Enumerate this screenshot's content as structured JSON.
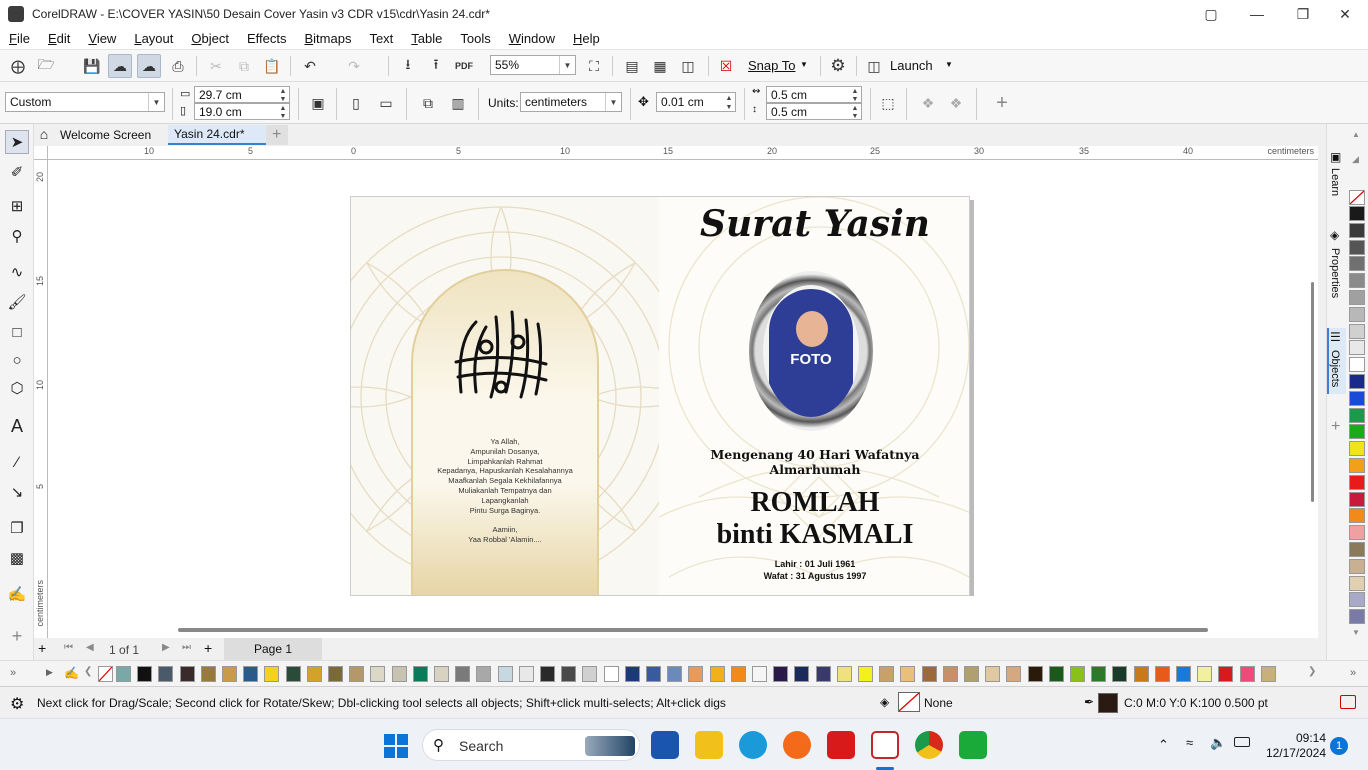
{
  "window": {
    "title": "CorelDRAW - E:\\COVER YASIN\\50 Desain Cover Yasin v3 CDR v15\\cdr\\Yasin 24.cdr*"
  },
  "menu": [
    {
      "key": "F",
      "rest": "ile"
    },
    {
      "key": "E",
      "rest": "dit"
    },
    {
      "key": "V",
      "rest": "iew"
    },
    {
      "key": "L",
      "rest": "ayout"
    },
    {
      "key": "O",
      "rest": "bject"
    },
    {
      "key": "",
      "rest": "Effects"
    },
    {
      "key": "B",
      "rest": "itmaps"
    },
    {
      "key": "",
      "rest": "Text"
    },
    {
      "key": "T",
      "rest": "able"
    },
    {
      "key": "",
      "rest": "Tools"
    },
    {
      "key": "W",
      "rest": "indow"
    },
    {
      "key": "H",
      "rest": "elp"
    }
  ],
  "toolbar": {
    "zoom": "55%",
    "snap_to": "Snap To",
    "launch": "Launch"
  },
  "property_bar": {
    "preset": "Custom",
    "width": "29.7 cm",
    "height": "19.0 cm",
    "units_label": "Units:",
    "units": "centimeters",
    "nudge": "0.01 cm",
    "dup_x": "0.5 cm",
    "dup_y": "0.5 cm"
  },
  "tabs": {
    "welcome": "Welcome Screen",
    "document": "Yasin 24.cdr*"
  },
  "rulers": {
    "unit": "centimeters",
    "h_ticks": [
      "10",
      "5",
      "0",
      "5",
      "10",
      "15",
      "20",
      "25",
      "30",
      "35",
      "40"
    ],
    "v_ticks": [
      "20",
      "15",
      "10",
      "5"
    ]
  },
  "design": {
    "title": "Surat Yasin",
    "photo_label": "FOTO",
    "prayer": [
      "Ya Allah,",
      "Ampunilah Dosanya,",
      "Limpahkanlah Rahmat",
      "Kepadanya, Hapuskanlah Kesalahannya",
      "Maafkanlah Segala Kekhilafannya",
      "Muliakanlah Tempatnya dan",
      "Lapangkanlah",
      "Pintu Surga Baginya.",
      "",
      "Aamiin,",
      "Yaa Robbal 'Alamin...."
    ],
    "memorial_line1": "Mengenang 40 Hari Wafatnya",
    "memorial_line2": "Almarhumah",
    "name_line1": "ROMLAH",
    "name_line2": "binti KASMALI",
    "born": "Lahir : 01 Juli 1961",
    "died": "Wafat : 31 Agustus 1997"
  },
  "dockers": {
    "learn": "Learn",
    "properties": "Properties",
    "objects": "Objects"
  },
  "pages": {
    "current": "1",
    "of_label": "of",
    "total": "1",
    "page_tab": "Page 1"
  },
  "status": {
    "hint": "Next click for Drag/Scale; Second click for Rotate/Skew; Dbl-clicking tool selects all objects; Shift+click multi-selects; Alt+click digs",
    "fill": "None",
    "outline": "C:0 M:0 Y:0 K:100  0.500 pt"
  },
  "taskbar": {
    "search": "Search",
    "time": "09:14",
    "date": "12/17/2024",
    "notifications": "1"
  },
  "palette_colors": [
    "#7aa8a8",
    "#111111",
    "#4a5a6a",
    "#3a2a2a",
    "#9a7a3a",
    "#c89a4a",
    "#2a5a8a",
    "#f2d21a",
    "#2a4a3a",
    "#d4a22a",
    "#7a6a3a",
    "#b4986a",
    "#dcd8c8",
    "#c8c2b0",
    "#0a7a5a",
    "#d8d2c2",
    "#7a7a7a",
    "#a8a8a8",
    "#c8d8e0",
    "#e8e8e8",
    "#2a2a2a",
    "#4a4a4a",
    "#d0d0d0",
    "#ffffff",
    "#1a3a7a",
    "#3a5aa0",
    "#6a8ab8",
    "#e89a5a",
    "#f2b01a",
    "#f28a1a",
    "#f5f5f5",
    "#2a1a4a",
    "#1a2a5a",
    "#3a3a6a",
    "#f0e080",
    "#f2f21a",
    "#c8a06a",
    "#e8c07a",
    "#9a6a3a",
    "#c8906a",
    "#b0a070",
    "#e0c8a0",
    "#d4a880",
    "#2a1a0a",
    "#1a5a1a",
    "#8ac01a",
    "#2a7a2a",
    "#1a3a2a",
    "#c87a1a",
    "#e85a1a",
    "#1a7ad8",
    "#f0f0a0",
    "#d81a1a",
    "#f04a7a",
    "#c8b07a"
  ],
  "vpalette_colors": [
    "#1a1a1a",
    "#3a3a3a",
    "#555555",
    "#707070",
    "#8a8a8a",
    "#a0a0a0",
    "#b8b8b8",
    "#d0d0d0",
    "#e8e8e8",
    "#ffffff",
    "#1a2a8a",
    "#1a4ad8",
    "#1a9a4a",
    "#1aaa1a",
    "#f2e21a",
    "#f2a01a",
    "#e81a1a",
    "#c81a3a",
    "#f28a1a",
    "#f0a0a0",
    "#8a7a5a",
    "#c8b090",
    "#e0d0b0",
    "#a8a8c8",
    "#7a7aa8"
  ]
}
